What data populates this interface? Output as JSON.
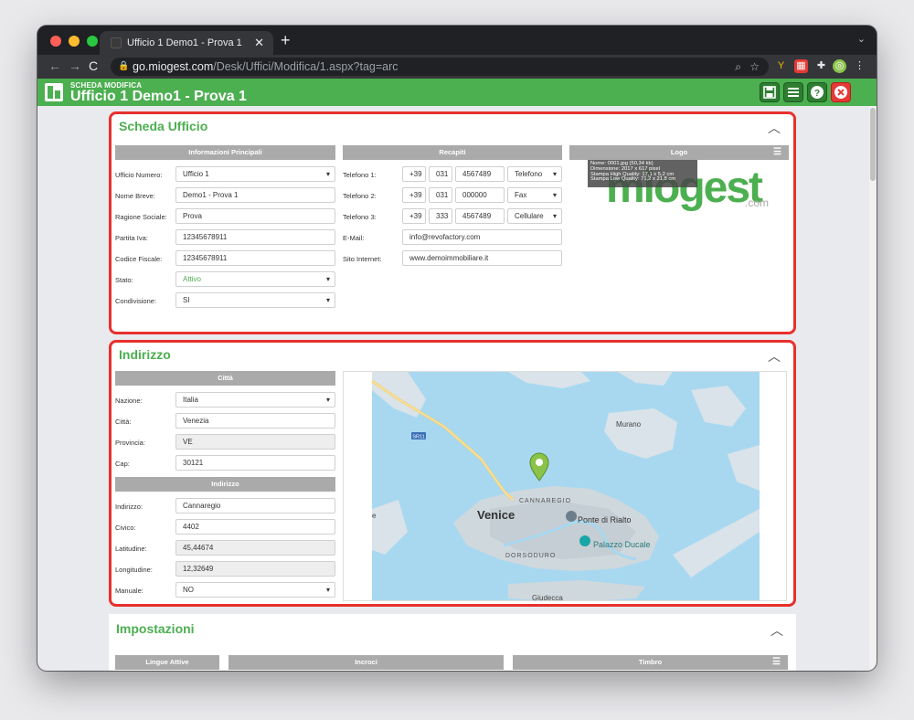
{
  "browser": {
    "tab_title": "Ufficio 1 Demo1 - Prova 1",
    "url_host": "go.miogest.com",
    "url_path": "/Desk/Uffici/Modifica/1.aspx?tag=arc"
  },
  "header": {
    "subtitle": "SCHEDA MODIFICA",
    "title": "Ufficio 1 Demo1 - Prova 1"
  },
  "scheda": {
    "title": "Scheda Ufficio",
    "info_header": "Informazioni Principali",
    "fields": [
      {
        "label": "Ufficio Numero:",
        "value": "Ufficio 1"
      },
      {
        "label": "Nome Breve:",
        "value": "Demo1 - Prova 1"
      },
      {
        "label": "Ragione Sociale:",
        "value": "Prova"
      },
      {
        "label": "Partita Iva:",
        "value": "12345678911"
      },
      {
        "label": "Codice Fiscale:",
        "value": "12345678911"
      },
      {
        "label": "Stato:",
        "value": "Attivo"
      },
      {
        "label": "Condivisione:",
        "value": "SI"
      }
    ],
    "recapiti_header": "Recapiti",
    "phones": [
      {
        "label": "Telefono 1:",
        "prefix": "+39",
        "area": "031",
        "number": "4567489",
        "type": "Telefono"
      },
      {
        "label": "Telefono 2:",
        "prefix": "+39",
        "area": "031",
        "number": "000000",
        "type": "Fax"
      },
      {
        "label": "Telefono 3:",
        "prefix": "+39",
        "area": "333",
        "number": "4567489",
        "type": "Cellulare"
      }
    ],
    "email_label": "E-Mail:",
    "email": "info@revofactory.com",
    "site_label": "Sito Internet:",
    "site": "www.demoimmobiliare.it",
    "logo_header": "Logo",
    "logo_tip": [
      "Nome: 0001.jpg (50,34 kb)",
      "Dimensione: 2017 x 617 pixel",
      "Stampa High Quality: 17,1 x 5,2 cm",
      "Stampa Low Quality: 71,2 x 21,8 cm"
    ],
    "logo_text": "miogest",
    "logo_com": ".com"
  },
  "indirizzo": {
    "title": "Indirizzo",
    "citta_header": "Città",
    "citta_fields": [
      {
        "label": "Nazione:",
        "value": "Italia"
      },
      {
        "label": "Città:",
        "value": "Venezia"
      },
      {
        "label": "Provincia:",
        "value": "VE"
      },
      {
        "label": "Cap:",
        "value": "30121"
      }
    ],
    "indirizzo_header": "Indirizzo",
    "addr_fields": [
      {
        "label": "Indirizzo:",
        "value": "Cannaregio"
      },
      {
        "label": "Civico:",
        "value": "4402"
      },
      {
        "label": "Latitudine:",
        "value": "45,44674"
      },
      {
        "label": "Longitudine:",
        "value": "12,32649"
      },
      {
        "label": "Manuale:",
        "value": "NO"
      }
    ],
    "map_labels": {
      "road": "SR11",
      "murano": "Murano",
      "cannaregio": "CANNAREGIO",
      "venice": "Venice",
      "rialto": "Ponte di Rialto",
      "ducale": "Palazzo Ducale",
      "dorsoduro": "DORSODURO",
      "giudecca": "Giudecca",
      "edge_e": "e"
    }
  },
  "impostazioni": {
    "title": "Impostazioni",
    "lingue_header": "Lingue Attive",
    "incroci_header": "Incroci",
    "timbro_header": "Timbro"
  },
  "colors": {
    "green": "#4caf50",
    "highlight_border": "#e8302c"
  }
}
